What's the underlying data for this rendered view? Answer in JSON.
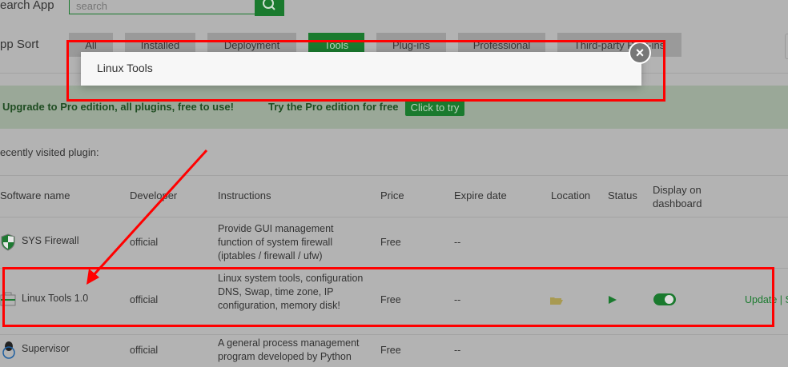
{
  "search": {
    "label": "earch App",
    "placeholder": "search"
  },
  "sort": {
    "label": "pp Sort",
    "tabs": [
      "All",
      "Installed",
      "Deployment",
      "Tools",
      "Plug-ins",
      "Professional",
      "Third-party Plug-ins"
    ]
  },
  "popup": {
    "title": "Linux Tools"
  },
  "banner": {
    "text": "Upgrade to Pro edition, all plugins, free to use!",
    "try_text": "Try the Pro edition for free",
    "button": "Click to try"
  },
  "recent": "ecently visited plugin:",
  "table": {
    "headers": [
      "Software name",
      "Developer",
      "Instructions",
      "Price",
      "Expire date",
      "Location",
      "Status",
      "Display on dashboard"
    ],
    "rows": [
      {
        "name": "SYS Firewall",
        "developer": "official",
        "instructions": "Provide GUI management function of system firewall (iptables / firewall / ufw)",
        "price": "Free",
        "expire": "--"
      },
      {
        "name": "Linux Tools 1.0",
        "developer": "official",
        "instructions": "Linux system tools, configuration DNS, Swap, time zone, IP configuration, memory disk!",
        "price": "Free",
        "expire": "--",
        "action": "Update | S"
      },
      {
        "name": "Supervisor",
        "developer": "official",
        "instructions": "A general process management program developed by Python",
        "price": "Free",
        "expire": "--"
      }
    ]
  }
}
